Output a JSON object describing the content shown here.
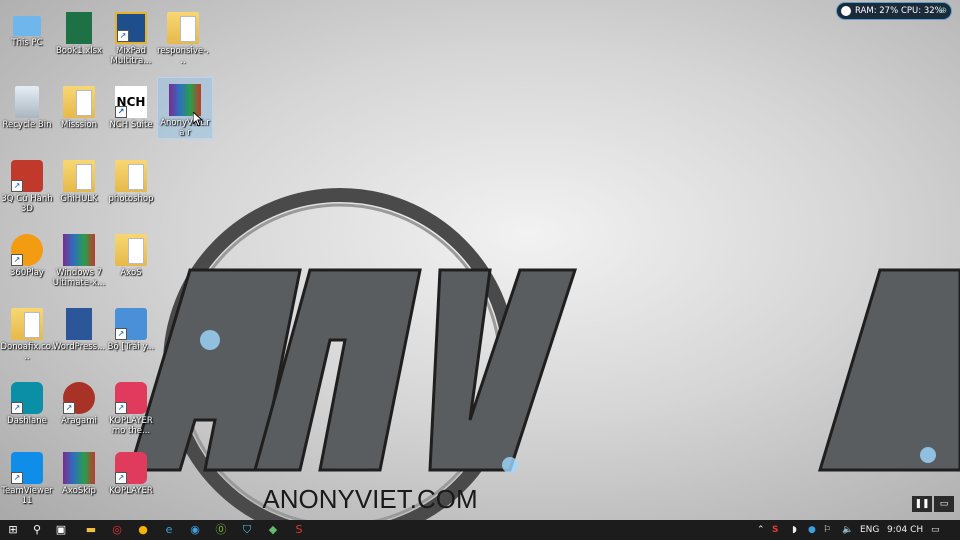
{
  "desktop": {
    "icons": [
      {
        "label": "This PC",
        "icon": "this-pc-icon"
      },
      {
        "label": "Book1.xlsx",
        "icon": "excel-icon"
      },
      {
        "label": "MixPad Multitra...",
        "icon": "mixpad-icon"
      },
      {
        "label": "responsive-...",
        "icon": "folder-icon"
      },
      {
        "label": "Recycle Bin",
        "icon": "recycle-bin-icon"
      },
      {
        "label": "Misssion",
        "icon": "folder-icon"
      },
      {
        "label": "NCH Suite",
        "icon": "nch-icon"
      },
      {
        "label": "AnonyViet.ra r",
        "icon": "winrar-icon"
      },
      {
        "label": "3Q Củ Hành 3D",
        "icon": "game-3q-icon"
      },
      {
        "label": "GhiHULK",
        "icon": "folder-icon"
      },
      {
        "label": "photoshop",
        "icon": "folder-icon"
      },
      {
        "label": "360Play",
        "icon": "360play-icon"
      },
      {
        "label": "Windows 7 Ultimate-x...",
        "icon": "winrar-icon"
      },
      {
        "label": "AxoS",
        "icon": "folder-icon"
      },
      {
        "label": "Donoafix.co...",
        "icon": "folder-icon"
      },
      {
        "label": "WordPress...",
        "icon": "word-icon"
      },
      {
        "label": "Bộ [Trải y...",
        "icon": "setup-icon"
      },
      {
        "label": "Dashlane",
        "icon": "dashlane-icon"
      },
      {
        "label": "Aragami",
        "icon": "aragami-icon"
      },
      {
        "label": "KOPLAYER mo the...",
        "icon": "koplayer-icon"
      },
      {
        "label": "TeamViewer 11",
        "icon": "teamviewer-icon"
      },
      {
        "label": "AxoSkip",
        "icon": "winrar-icon"
      },
      {
        "label": "KOPLAYER",
        "icon": "koplayer-icon"
      }
    ]
  },
  "wallpaper": {
    "logo_text": "ANONYVIET.COM"
  },
  "system_monitor": {
    "ram": "RAM: 27%",
    "cpu": "CPU: 32%"
  },
  "taskbar": {
    "language": "ENG",
    "time": "9:04 CH"
  },
  "colors": {
    "taskbar": "#1c1c1c",
    "accent": "#3b9fe0"
  }
}
